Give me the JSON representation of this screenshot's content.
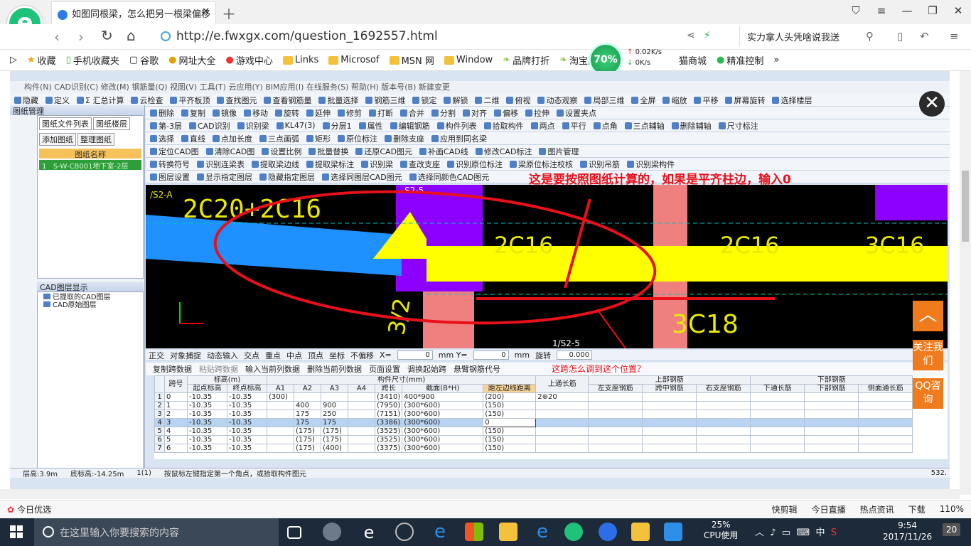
{
  "browser": {
    "tab_title": "如图同根梁，怎么把另一根梁偏移",
    "url": "http://e.fwxgx.com/question_1692557.html",
    "search_text": "实力拿人头凭啥说我送",
    "bookmarks": [
      "收藏",
      "手机收藏夹",
      "谷歌",
      "网址大全",
      "游戏中心",
      "Links",
      "Microsof",
      "MSN 网",
      "Window",
      "品牌打折",
      "淘宝团购",
      "猫商城",
      "精准控制"
    ],
    "speed_percent": "70%",
    "speed_up": "0.02K/s",
    "speed_down": "0K/s",
    "status_left": "今日优选",
    "status_right": [
      "快剪辑",
      "今日直播",
      "热点资讯",
      "下载",
      "110%"
    ]
  },
  "app": {
    "menubar": "构件(N)   CAD识别(C)   修改(M)   钢筋量(Q)   视图(V)   工具(T)   云应用(Y)   BIM应用(I)   在线服务(S)   帮助(H)   版本号(B)   新建变更   ",
    "toolbar1": [
      "隐藏",
      "定义",
      "Σ 汇总计算",
      "云检查",
      "平齐板顶",
      "查找图元",
      "查看钢筋量",
      "批量选择",
      "钢筋三维",
      "锁定",
      "解锁",
      "二维",
      "俯视",
      "动态观察",
      "局部三维",
      "全屏",
      "缩放",
      "平移",
      "屏幕旋转",
      "选择楼层"
    ],
    "toolbar2": [
      "删除",
      "复制",
      "镜像",
      "移动",
      "旋转",
      "延伸",
      "修剪",
      "打断",
      "合并",
      "分割",
      "对齐",
      "偏移",
      "拉伸",
      "设置夹点"
    ],
    "toolbar3": [
      "第-3层",
      "CAD识别",
      "识别梁",
      "KL47(3)",
      "分层1",
      "属性",
      "编辑钢筋",
      "构件列表",
      "拾取构件",
      "两点",
      "平行",
      "点角",
      "三点辅轴",
      "删除辅轴",
      "尺寸标注"
    ],
    "toolbar4": [
      "选择",
      "直线",
      "点加长度",
      "三点画弧",
      "矩形",
      "原位标注",
      "删除支座",
      "应用到同名梁"
    ],
    "toolbar5": [
      "定位CAD图",
      "清除CAD图",
      "设置比例",
      "批量替换",
      "还原CAD图元",
      "补画CAD线",
      "修改CAD标注",
      "图片管理"
    ],
    "toolbar6": [
      "转换符号",
      "识别连梁表",
      "提取梁边线",
      "提取梁标注",
      "识别梁",
      "查改支座",
      "识别原位标注",
      "梁原位标注校核",
      "识别吊筋",
      "识别梁构件"
    ],
    "toolbar7": [
      "图层设置",
      "显示指定图层",
      "隐藏指定图层",
      "选择同图层CAD图元",
      "选择同颜色CAD图元"
    ],
    "left_panel": {
      "title": "图纸管理",
      "tabs": [
        "图纸文件列表",
        "图纸楼层"
      ],
      "buttons": [
        "添加图纸",
        "整理图纸"
      ],
      "col_header": "图纸名称",
      "row_num": "1",
      "row_name": "S-W-CB001地下室-2层",
      "cad_title": "CAD图层显示",
      "cad_items": [
        "已提取的CAD图层",
        "CAD原始图层"
      ]
    },
    "canvas_labels": [
      "/S2-A",
      "2C20+2C16",
      "S2-5",
      "2C16",
      "2C16",
      "3C16",
      "3/2",
      "3C18",
      "1/S2-5"
    ],
    "annotation_title": "这是要按照图纸计算的，如果是平齐柱边，输入0",
    "annotation_question": "这跨怎么调到这个位置？",
    "bottom_tools": [
      "正交",
      "对象捕捉",
      "动态输入",
      "交点",
      "重点",
      "中点",
      "顶点",
      "坐标",
      "不偏移",
      "X=",
      "mm Y=",
      "mm",
      "旋转"
    ],
    "bottom_values": {
      "x": "0",
      "y": "0",
      "rotate": "0.000"
    },
    "table_tools": [
      "复制跨数据",
      "粘贴跨数据",
      "输入当前列数据",
      "删除当前列数据",
      "页面设置",
      "调换起始跨",
      "悬臂钢筋代号"
    ],
    "table": {
      "top_headers": [
        "跨号",
        "标高(m)",
        "构件尺寸(mm)",
        "上通长筋",
        "上部钢筋",
        "下部钢筋"
      ],
      "sub_headers": [
        "起点标高",
        "终点标高",
        "A1",
        "A2",
        "A3",
        "A4",
        "跨长",
        "截面(B*H)",
        "距左边线距离",
        "左支座钢筋",
        "跨中钢筋",
        "右支座钢筋",
        "下通长筋",
        "下部钢筋",
        "侧面通长筋"
      ],
      "rows": [
        [
          "1",
          "0",
          "-10.35",
          "-10.35",
          "(300)",
          "",
          "",
          "",
          "(3410)",
          "400*900",
          "(200)",
          "2⊕20"
        ],
        [
          "2",
          "1",
          "-10.35",
          "-10.35",
          "",
          "400",
          "900",
          "",
          "(7950)",
          "(300*600)",
          "(150)",
          ""
        ],
        [
          "3",
          "2",
          "-10.35",
          "-10.35",
          "",
          "175",
          "250",
          "",
          "(7151)",
          "(300*600)",
          "(150)",
          ""
        ],
        [
          "4",
          "3",
          "-10.35",
          "-10.35",
          "",
          "175",
          "175",
          "",
          "(3386)",
          "(300*600)",
          "0",
          ""
        ],
        [
          "5",
          "4",
          "-10.35",
          "-10.35",
          "",
          "(175)",
          "(175)",
          "",
          "(3525)",
          "(300*600)",
          "(150)",
          ""
        ],
        [
          "6",
          "5",
          "-10.35",
          "-10.35",
          "",
          "(175)",
          "(175)",
          "",
          "(3525)",
          "(300*600)",
          "(150)",
          ""
        ],
        [
          "7",
          "6",
          "-10.35",
          "-10.35",
          "",
          "(175)",
          "(400)",
          "",
          "(3375)",
          "(300*600)",
          "(150)",
          ""
        ]
      ]
    },
    "status": [
      "层高:3.9m",
      "底标高:-14.25m",
      "1(1)",
      "按鼠标左键指定第一个角点，或拾取构件图元",
      "532."
    ]
  },
  "side_widgets": {
    "follow": "关注我们",
    "qq": "QQ咨询"
  },
  "taskbar": {
    "search_placeholder": "在这里输入你要搜索的内容",
    "cpu_percent": "25%",
    "cpu_label": "CPU使用",
    "ime": "中",
    "time": "9:54",
    "date": "2017/11/26",
    "notifications": "20"
  },
  "colors": {
    "beam_yellow": "#ffff00",
    "beam_blue": "#1e90ff",
    "column_purple": "#8b00ff",
    "column_pink": "#f08080",
    "annotation_red": "#e8101a",
    "accent_orange": "#f07b1d"
  }
}
